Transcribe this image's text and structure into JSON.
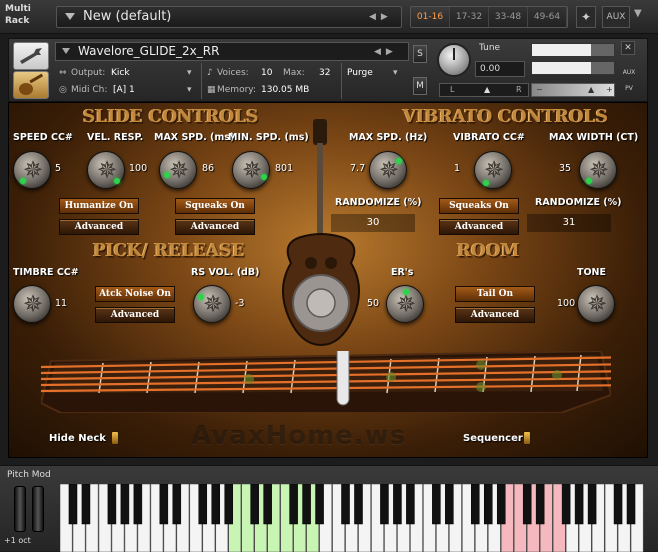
{
  "rack": {
    "label_line1": "Multi",
    "label_line2": "Rack",
    "preset_name": "New (default)",
    "tabs": [
      {
        "label": "01-16",
        "active": true
      },
      {
        "label": "17-32",
        "active": false
      },
      {
        "label": "33-48",
        "active": false
      },
      {
        "label": "49-64",
        "active": false
      }
    ],
    "aux_label": "AUX"
  },
  "instrument": {
    "name": "Wavelore_GLIDE_2x_RR",
    "output_label": "Output:",
    "output_value": "Kick",
    "voices_label": "Voices:",
    "voices_value": "10",
    "max_label": "Max:",
    "max_value": "32",
    "purge_label": "Purge",
    "midi_label": "Midi Ch:",
    "midi_value": "[A]  1",
    "memory_label": "Memory:",
    "memory_value": "130.05 MB",
    "solo_label": "S",
    "mute_label": "M",
    "tune_label": "Tune",
    "tune_value": "0.00",
    "pan_left": "L",
    "pan_right": "R",
    "aux_side": "AUX",
    "pv_side": "PV"
  },
  "slide": {
    "title": "SLIDE CONTROLS",
    "speed_cc_label": "SPEED CC#",
    "speed_cc_value": "5",
    "vel_resp_label": "VEL. RESP.",
    "vel_resp_value": "100",
    "max_spd_label": "MAX SPD. (ms)",
    "max_spd_value": "86",
    "min_spd_label": "MIN. SPD. (ms)",
    "min_spd_value": "801",
    "humanize_label": "Humanize On",
    "advanced1_label": "Advanced",
    "squeaks_label": "Squeaks On",
    "advanced2_label": "Advanced"
  },
  "vibrato": {
    "title": "VIBRATO CONTROLS",
    "max_spd_label": "MAX SPD. (Hz)",
    "max_spd_value": "7.7",
    "vibrato_cc_label": "VIBRATO CC#",
    "vibrato_cc_value": "1",
    "max_width_label": "MAX WIDTH (CT)",
    "max_width_value": "35",
    "randomize1_label": "RANDOMIZE (%)",
    "randomize1_value": "30",
    "squeaks_label": "Squeaks On",
    "advanced_label": "Advanced",
    "randomize2_label": "RANDOMIZE (%)",
    "randomize2_value": "31"
  },
  "pick": {
    "title": "PICK/ RELEASE",
    "timbre_cc_label": "TIMBRE CC#",
    "timbre_cc_value": "11",
    "atck_noise_label": "Atck Noise On",
    "advanced_label": "Advanced",
    "rs_vol_label": "RS VOL. (dB)",
    "rs_vol_value": "-3"
  },
  "room": {
    "title": "ROOM",
    "ers_label": "ER's",
    "ers_value": "50",
    "tail_label": "Tail  On",
    "advanced_label": "Advanced",
    "tone_label": "TONE",
    "tone_value": "100"
  },
  "footer": {
    "hide_neck_label": "Hide Neck",
    "sequencer_label": "Sequencer",
    "watermark": "AvaxHome.ws"
  },
  "keyboard": {
    "pitch_mod_label": "Pitch Mod",
    "octave_label": "+1 oct",
    "green_zone_color": "#c9f5b4",
    "red_zone_color": "#f5b8be"
  },
  "colors": {
    "accent_orange": "#ff9c4a",
    "knob_indicator": "#2dd44a",
    "title_gold": "#c2883c"
  }
}
